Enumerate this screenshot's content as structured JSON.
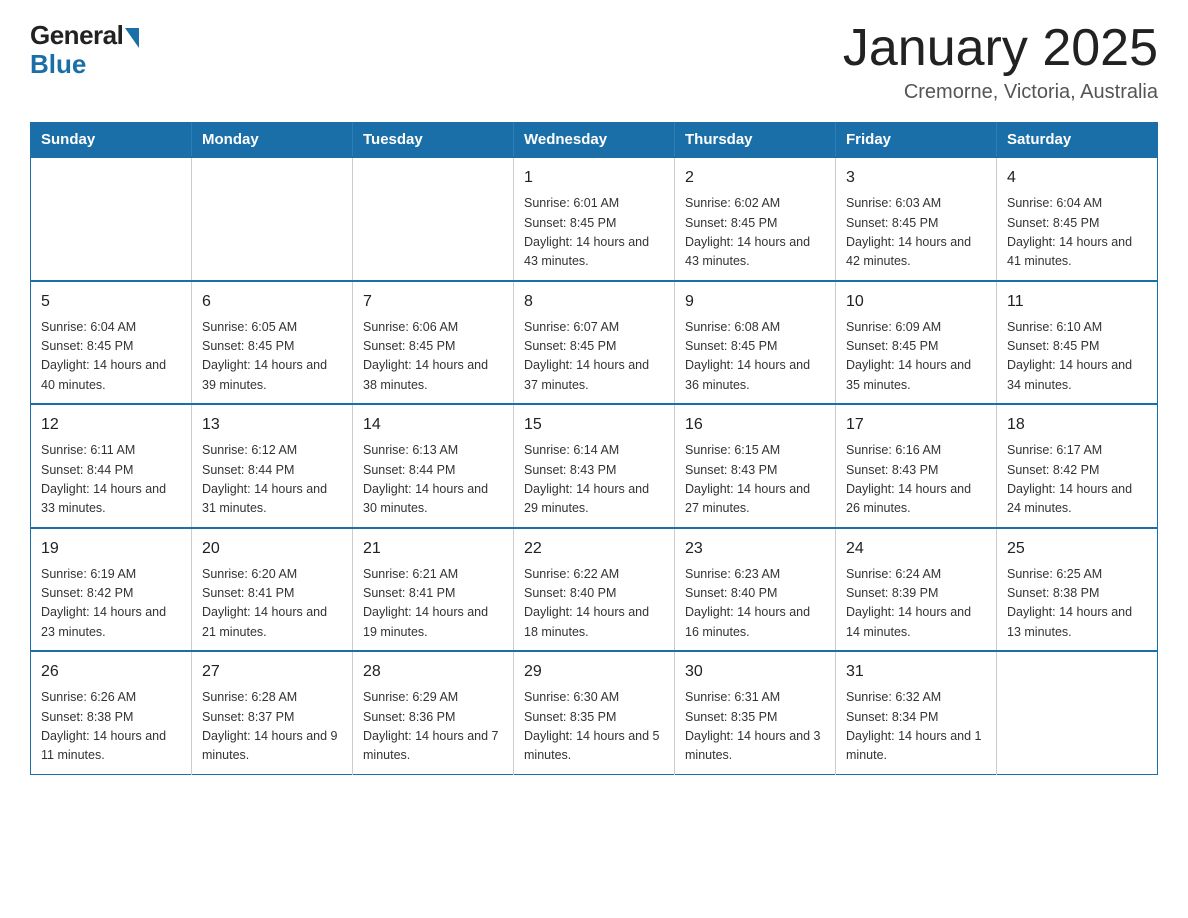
{
  "logo": {
    "general": "General",
    "blue": "Blue"
  },
  "header": {
    "title": "January 2025",
    "location": "Cremorne, Victoria, Australia"
  },
  "days_of_week": [
    "Sunday",
    "Monday",
    "Tuesday",
    "Wednesday",
    "Thursday",
    "Friday",
    "Saturday"
  ],
  "weeks": [
    [
      {
        "day": "",
        "info": ""
      },
      {
        "day": "",
        "info": ""
      },
      {
        "day": "",
        "info": ""
      },
      {
        "day": "1",
        "info": "Sunrise: 6:01 AM\nSunset: 8:45 PM\nDaylight: 14 hours and 43 minutes."
      },
      {
        "day": "2",
        "info": "Sunrise: 6:02 AM\nSunset: 8:45 PM\nDaylight: 14 hours and 43 minutes."
      },
      {
        "day": "3",
        "info": "Sunrise: 6:03 AM\nSunset: 8:45 PM\nDaylight: 14 hours and 42 minutes."
      },
      {
        "day": "4",
        "info": "Sunrise: 6:04 AM\nSunset: 8:45 PM\nDaylight: 14 hours and 41 minutes."
      }
    ],
    [
      {
        "day": "5",
        "info": "Sunrise: 6:04 AM\nSunset: 8:45 PM\nDaylight: 14 hours and 40 minutes."
      },
      {
        "day": "6",
        "info": "Sunrise: 6:05 AM\nSunset: 8:45 PM\nDaylight: 14 hours and 39 minutes."
      },
      {
        "day": "7",
        "info": "Sunrise: 6:06 AM\nSunset: 8:45 PM\nDaylight: 14 hours and 38 minutes."
      },
      {
        "day": "8",
        "info": "Sunrise: 6:07 AM\nSunset: 8:45 PM\nDaylight: 14 hours and 37 minutes."
      },
      {
        "day": "9",
        "info": "Sunrise: 6:08 AM\nSunset: 8:45 PM\nDaylight: 14 hours and 36 minutes."
      },
      {
        "day": "10",
        "info": "Sunrise: 6:09 AM\nSunset: 8:45 PM\nDaylight: 14 hours and 35 minutes."
      },
      {
        "day": "11",
        "info": "Sunrise: 6:10 AM\nSunset: 8:45 PM\nDaylight: 14 hours and 34 minutes."
      }
    ],
    [
      {
        "day": "12",
        "info": "Sunrise: 6:11 AM\nSunset: 8:44 PM\nDaylight: 14 hours and 33 minutes."
      },
      {
        "day": "13",
        "info": "Sunrise: 6:12 AM\nSunset: 8:44 PM\nDaylight: 14 hours and 31 minutes."
      },
      {
        "day": "14",
        "info": "Sunrise: 6:13 AM\nSunset: 8:44 PM\nDaylight: 14 hours and 30 minutes."
      },
      {
        "day": "15",
        "info": "Sunrise: 6:14 AM\nSunset: 8:43 PM\nDaylight: 14 hours and 29 minutes."
      },
      {
        "day": "16",
        "info": "Sunrise: 6:15 AM\nSunset: 8:43 PM\nDaylight: 14 hours and 27 minutes."
      },
      {
        "day": "17",
        "info": "Sunrise: 6:16 AM\nSunset: 8:43 PM\nDaylight: 14 hours and 26 minutes."
      },
      {
        "day": "18",
        "info": "Sunrise: 6:17 AM\nSunset: 8:42 PM\nDaylight: 14 hours and 24 minutes."
      }
    ],
    [
      {
        "day": "19",
        "info": "Sunrise: 6:19 AM\nSunset: 8:42 PM\nDaylight: 14 hours and 23 minutes."
      },
      {
        "day": "20",
        "info": "Sunrise: 6:20 AM\nSunset: 8:41 PM\nDaylight: 14 hours and 21 minutes."
      },
      {
        "day": "21",
        "info": "Sunrise: 6:21 AM\nSunset: 8:41 PM\nDaylight: 14 hours and 19 minutes."
      },
      {
        "day": "22",
        "info": "Sunrise: 6:22 AM\nSunset: 8:40 PM\nDaylight: 14 hours and 18 minutes."
      },
      {
        "day": "23",
        "info": "Sunrise: 6:23 AM\nSunset: 8:40 PM\nDaylight: 14 hours and 16 minutes."
      },
      {
        "day": "24",
        "info": "Sunrise: 6:24 AM\nSunset: 8:39 PM\nDaylight: 14 hours and 14 minutes."
      },
      {
        "day": "25",
        "info": "Sunrise: 6:25 AM\nSunset: 8:38 PM\nDaylight: 14 hours and 13 minutes."
      }
    ],
    [
      {
        "day": "26",
        "info": "Sunrise: 6:26 AM\nSunset: 8:38 PM\nDaylight: 14 hours and 11 minutes."
      },
      {
        "day": "27",
        "info": "Sunrise: 6:28 AM\nSunset: 8:37 PM\nDaylight: 14 hours and 9 minutes."
      },
      {
        "day": "28",
        "info": "Sunrise: 6:29 AM\nSunset: 8:36 PM\nDaylight: 14 hours and 7 minutes."
      },
      {
        "day": "29",
        "info": "Sunrise: 6:30 AM\nSunset: 8:35 PM\nDaylight: 14 hours and 5 minutes."
      },
      {
        "day": "30",
        "info": "Sunrise: 6:31 AM\nSunset: 8:35 PM\nDaylight: 14 hours and 3 minutes."
      },
      {
        "day": "31",
        "info": "Sunrise: 6:32 AM\nSunset: 8:34 PM\nDaylight: 14 hours and 1 minute."
      },
      {
        "day": "",
        "info": ""
      }
    ]
  ]
}
